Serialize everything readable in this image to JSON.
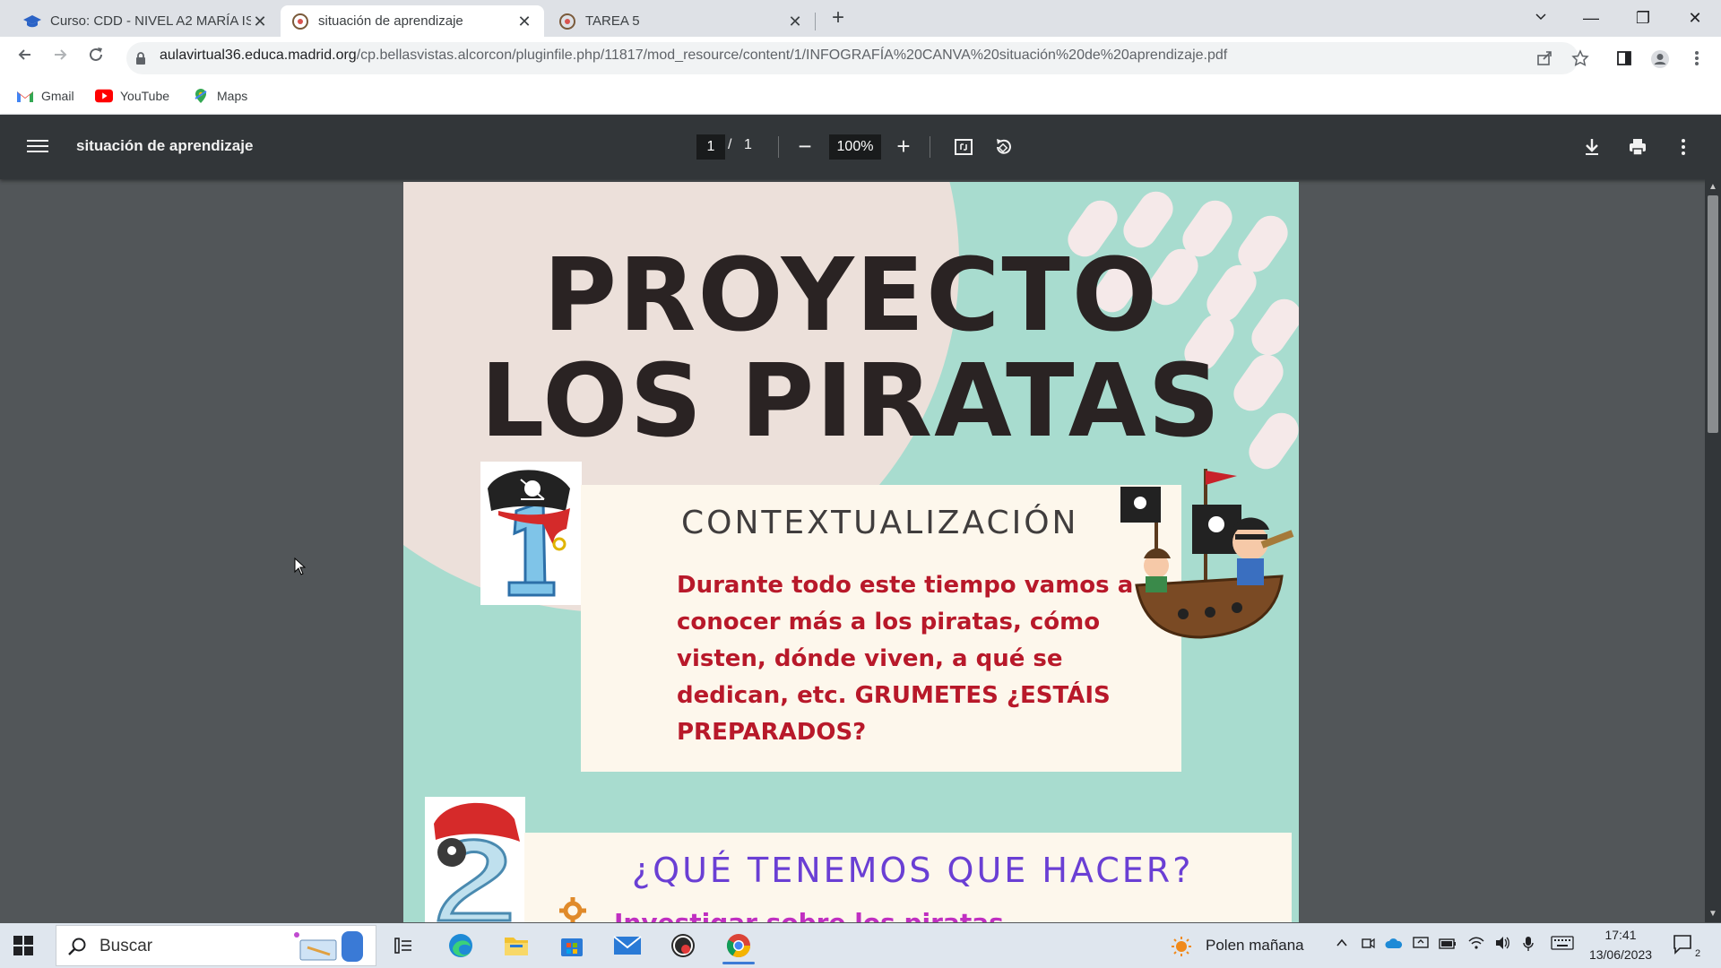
{
  "browser": {
    "tabs": [
      {
        "title": "Curso: CDD - NIVEL A2 MARÍA IS",
        "close": "✕"
      },
      {
        "title": "situación de aprendizaje",
        "close": "✕"
      },
      {
        "title": "TAREA 5",
        "close": "✕"
      }
    ],
    "new_tab": "+",
    "window_controls": {
      "minimize": "—",
      "restore": "❐",
      "close": "✕"
    },
    "url_host": "aulavirtual36.educa.madrid.org",
    "url_path": "/cp.bellasvistas.alcorcon/pluginfile.php/11817/mod_resource/content/1/INFOGRAFÍA%20CANVA%20situación%20de%20aprendizaje.pdf",
    "bookmarks": [
      "Gmail",
      "YouTube",
      "Maps"
    ]
  },
  "pdf_viewer": {
    "title": "situación de aprendizaje",
    "page_current": "1",
    "page_separator": "/",
    "page_total": "1",
    "zoom": "100%",
    "zoom_out": "−",
    "zoom_in": "+"
  },
  "document": {
    "title_line1": "PROYECTO",
    "title_line2": "LOS PIRATAS",
    "section1_heading": "CONTEXTUALIZACIÓN",
    "section1_body": "Durante todo este tiempo vamos a conocer más a los piratas, cómo visten, dónde viven, a qué se dedican, etc. GRUMETES ¿ESTÁIS PREPARADOS?",
    "section2_heading": "¿QUÉ TENEMOS QUE HACER?",
    "section2_sub": "Investigar sobre los piratas"
  },
  "taskbar": {
    "search_placeholder": "Buscar",
    "weather": "Polen mañana",
    "time": "17:41",
    "date": "13/06/2023",
    "notifications": "2"
  },
  "colors": {
    "page_bg": "#a8dccf",
    "title": "#2a2323",
    "body_red": "#b8192a",
    "heading_purple": "#6a3fd4"
  }
}
